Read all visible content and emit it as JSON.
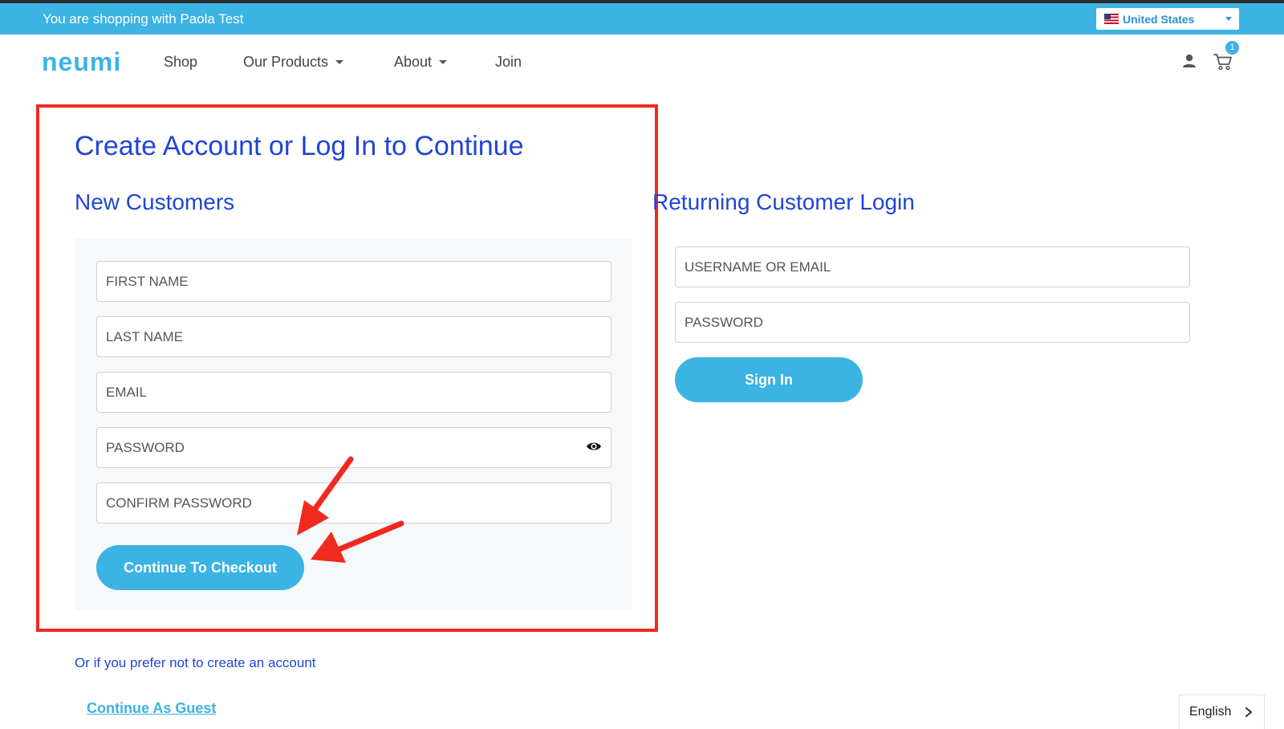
{
  "topbar": {
    "shopping_text": "You are shopping with Paola Test",
    "country": "United States"
  },
  "nav": {
    "logo": "neumi",
    "items": [
      {
        "label": "Shop"
      },
      {
        "label": "Our Products"
      },
      {
        "label": "About"
      },
      {
        "label": "Join"
      }
    ],
    "cart_count": "1"
  },
  "page": {
    "title": "Create Account or Log In to Continue"
  },
  "new_customers": {
    "heading": "New Customers",
    "first_name_placeholder": "FIRST NAME",
    "last_name_placeholder": "LAST NAME",
    "email_placeholder": "EMAIL",
    "password_placeholder": "PASSWORD",
    "confirm_password_placeholder": "CONFIRM PASSWORD",
    "submit_label": "Continue To Checkout"
  },
  "returning": {
    "heading": "Returning Customer Login",
    "username_placeholder": "USERNAME OR EMAIL",
    "password_placeholder": "PASSWORD",
    "submit_label": "Sign In"
  },
  "guest": {
    "prefer_text": "Or if you prefer not to create an account",
    "link_label": "Continue As Guest"
  },
  "language": {
    "selected": "English"
  },
  "colors": {
    "accent": "#3bb3e3",
    "heading_blue": "#1f45d6",
    "highlight_red": "#ef2a1f"
  }
}
